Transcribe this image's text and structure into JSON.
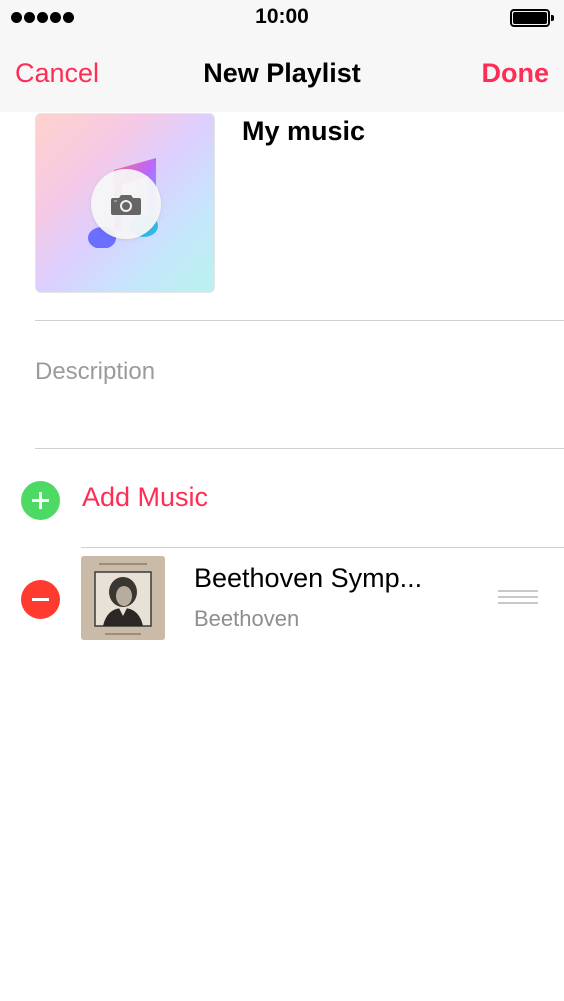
{
  "status_bar": {
    "time": "10:00"
  },
  "nav": {
    "cancel_label": "Cancel",
    "title": "New Playlist",
    "done_label": "Done"
  },
  "playlist": {
    "name": "My music",
    "description_placeholder": "Description"
  },
  "actions": {
    "add_music_label": "Add Music"
  },
  "songs": [
    {
      "title": "Beethoven Symp...",
      "artist": "Beethoven"
    }
  ],
  "colors": {
    "accent": "#ff2d55",
    "add": "#4cd964",
    "remove": "#ff3b30",
    "nav_bg": "#f7f7f7"
  },
  "icons": [
    "signal-icon",
    "battery-icon",
    "music-note-icon",
    "camera-icon",
    "add-icon",
    "remove-icon",
    "reorder-icon"
  ]
}
